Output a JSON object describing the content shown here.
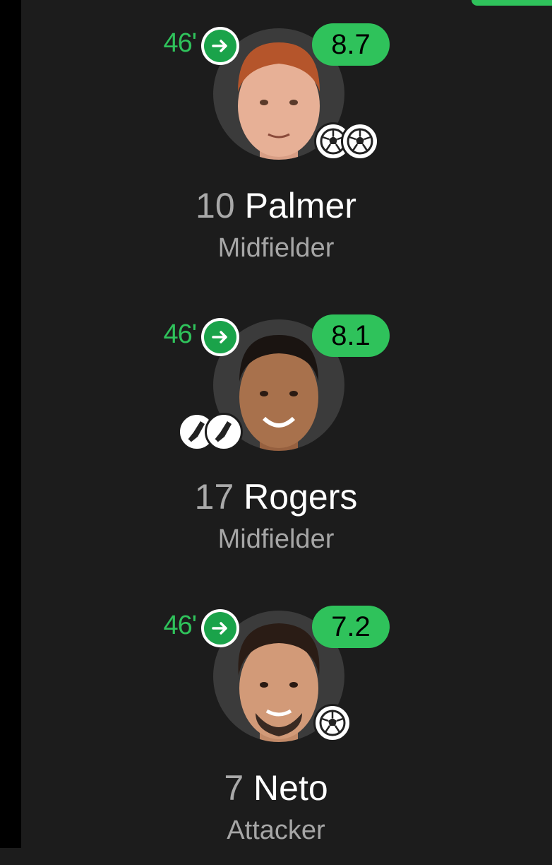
{
  "players": [
    {
      "sub_minute": "46'",
      "rating": "8.7",
      "number": "10",
      "name": "Palmer",
      "position": "Midfielder",
      "sub_icon": "arrow-right-icon",
      "events": [
        "goal-icon",
        "goal-icon"
      ],
      "skin": "#e7b096",
      "hair": "#b5552b"
    },
    {
      "sub_minute": "46'",
      "rating": "8.1",
      "number": "17",
      "name": "Rogers",
      "position": "Midfielder",
      "sub_icon": "arrow-right-icon",
      "events": [
        "boot-icon",
        "boot-icon"
      ],
      "skin": "#a8714c",
      "hair": "#1a1411"
    },
    {
      "sub_minute": "46'",
      "rating": "7.2",
      "number": "7",
      "name": "Neto",
      "position": "Attacker",
      "sub_icon": "arrow-right-icon",
      "events": [
        "goal-icon"
      ],
      "skin": "#d29a78",
      "hair": "#2a1c15"
    }
  ],
  "colors": {
    "accent": "#2fc25b",
    "background": "#1c1c1c"
  }
}
